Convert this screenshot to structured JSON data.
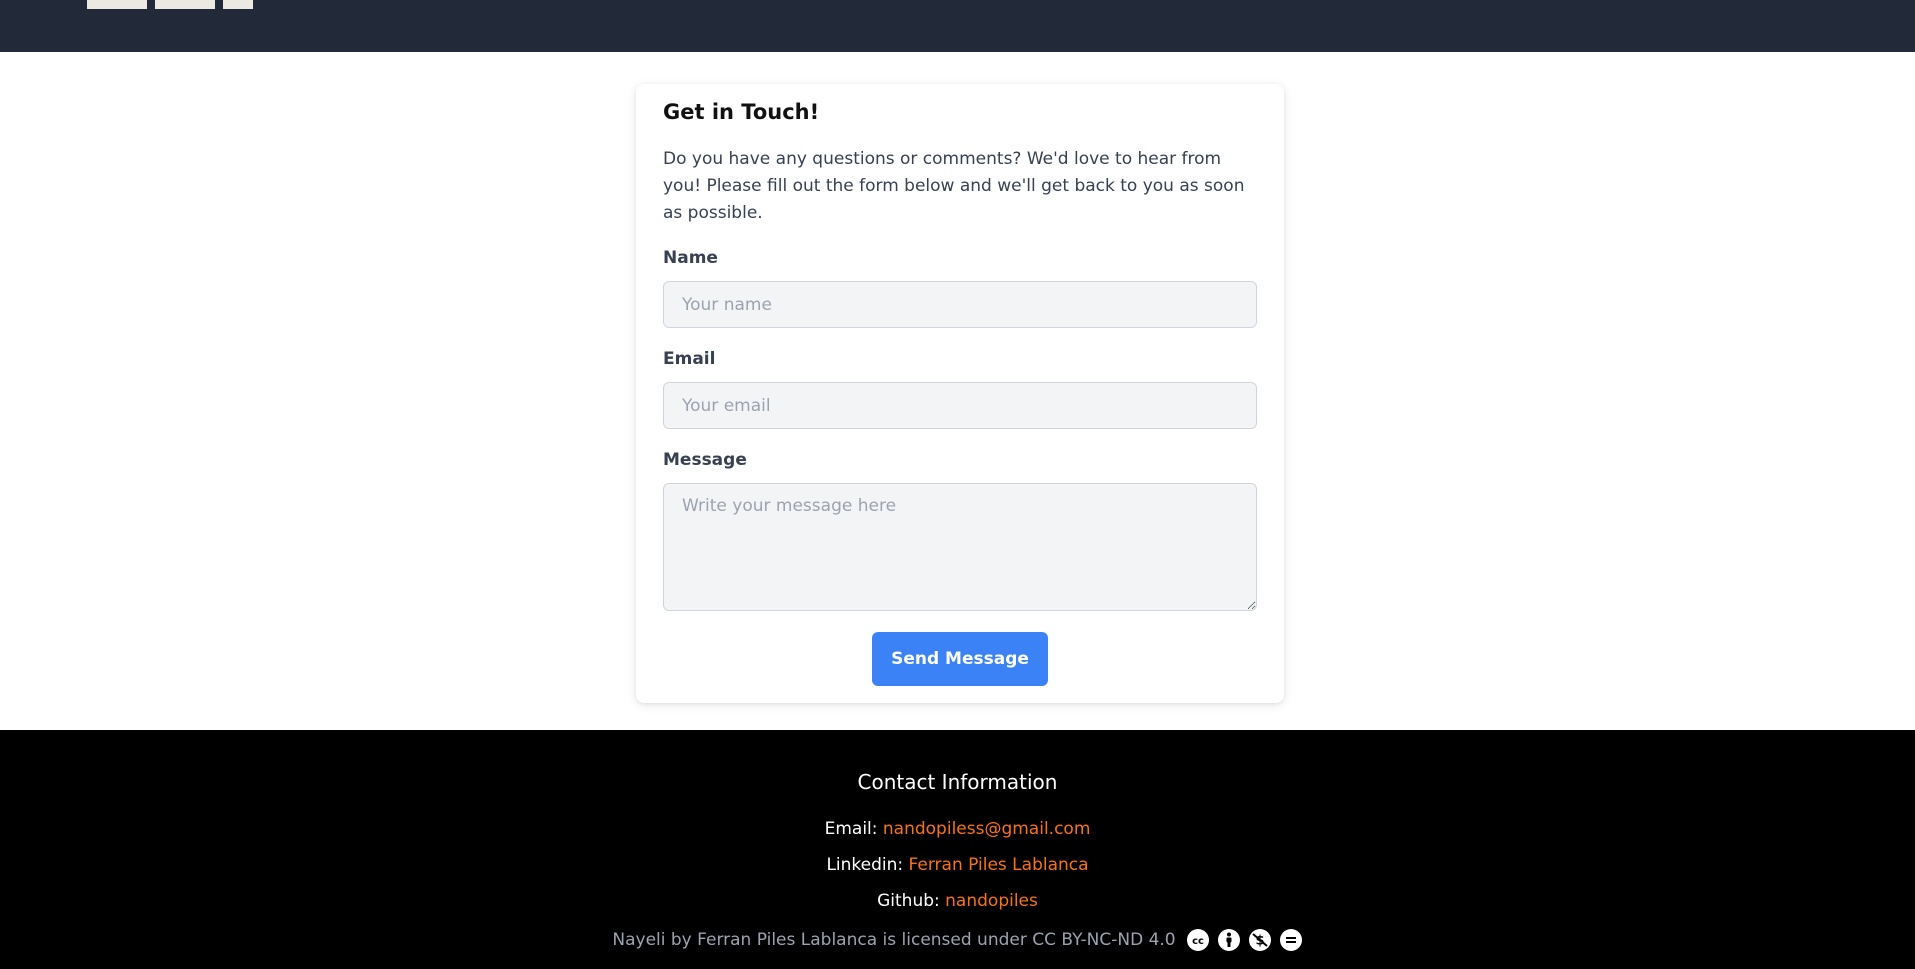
{
  "form": {
    "title": "Get in Touch!",
    "intro": "Do you have any questions or comments? We'd love to hear from you! Please fill out the form below and we'll get back to you as soon as possible.",
    "name_label": "Name",
    "name_placeholder": "Your name",
    "email_label": "Email",
    "email_placeholder": "Your email",
    "message_label": "Message",
    "message_placeholder": "Write your message here",
    "submit_label": "Send Message"
  },
  "footer": {
    "heading": "Contact Information",
    "email_label": "Email:",
    "email_value": "nandopiless@gmail.com",
    "linkedin_label": "Linkedin:",
    "linkedin_value": "Ferran Piles Lablanca",
    "github_label": "Github:",
    "github_value": "nandopiles",
    "license_text": "Nayeli by Ferran Piles Lablanca is licensed under CC BY-NC-ND 4.0",
    "license_icons": [
      "cc-icon",
      "by-icon",
      "nc-icon",
      "nd-icon"
    ]
  },
  "colors": {
    "header_bg": "#222a3a",
    "footer_bg": "#000000",
    "accent_link": "#f97316",
    "button": "#3b82f6"
  }
}
